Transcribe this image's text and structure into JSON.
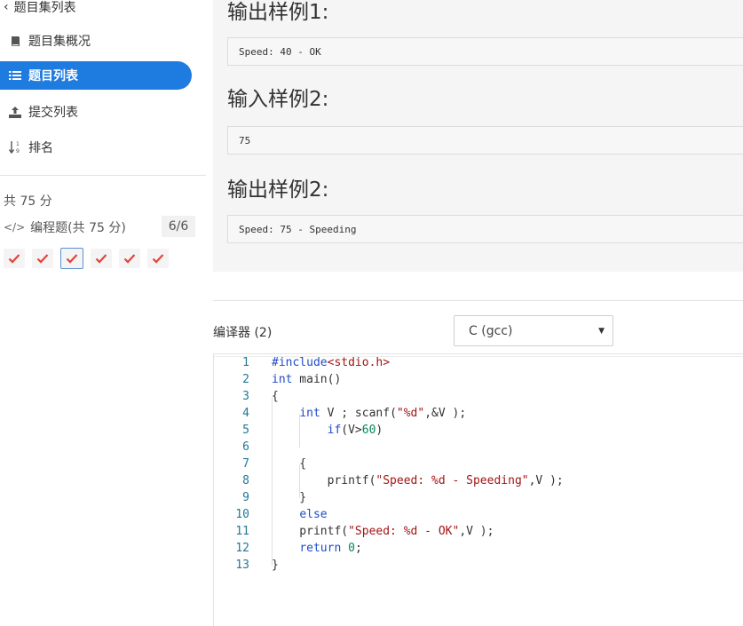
{
  "sidebar": {
    "back_label": "题目集列表",
    "nav": [
      {
        "label": "题目集概况",
        "icon": "book-icon",
        "active": false
      },
      {
        "label": "题目列表",
        "icon": "list-icon",
        "active": true
      },
      {
        "label": "提交列表",
        "icon": "upload-icon",
        "active": false
      },
      {
        "label": "排名",
        "icon": "sort-icon",
        "active": false
      }
    ],
    "total_score": "共 75 分",
    "category": "编程题(共 75 分)",
    "progress": "6/6",
    "problems": [
      {
        "status": "accepted"
      },
      {
        "status": "accepted"
      },
      {
        "status": "accepted",
        "selected": true
      },
      {
        "status": "accepted"
      },
      {
        "status": "accepted"
      },
      {
        "status": "accepted"
      }
    ],
    "accent_color": "#1e7be0",
    "check_color": "#e0453a"
  },
  "problem": {
    "output1_title": "输出样例1:",
    "output1_value": "Speed: 40 - OK",
    "input2_title": "输入样例2:",
    "input2_value": "75",
    "output2_title": "输出样例2:",
    "output2_value": "Speed: 75 - Speeding"
  },
  "compiler": {
    "label": "编译器 (2)",
    "language": "C (gcc)"
  },
  "editor": {
    "lines": [
      {
        "no": "1",
        "code": "#include<stdio.h>"
      },
      {
        "no": "2",
        "code": "int main()"
      },
      {
        "no": "3",
        "code": "{"
      },
      {
        "no": "4",
        "code": "    int V ; scanf(\"%d\",&V );"
      },
      {
        "no": "5",
        "code": "        if(V>60)"
      },
      {
        "no": "6",
        "code": ""
      },
      {
        "no": "7",
        "code": "    {"
      },
      {
        "no": "8",
        "code": "        printf(\"Speed: %d - Speeding\",V );"
      },
      {
        "no": "9",
        "code": "    }"
      },
      {
        "no": "10",
        "code": "    else"
      },
      {
        "no": "11",
        "code": "    printf(\"Speed: %d - OK\",V );"
      },
      {
        "no": "12",
        "code": "    return 0;"
      },
      {
        "no": "13",
        "code": "}"
      }
    ]
  }
}
